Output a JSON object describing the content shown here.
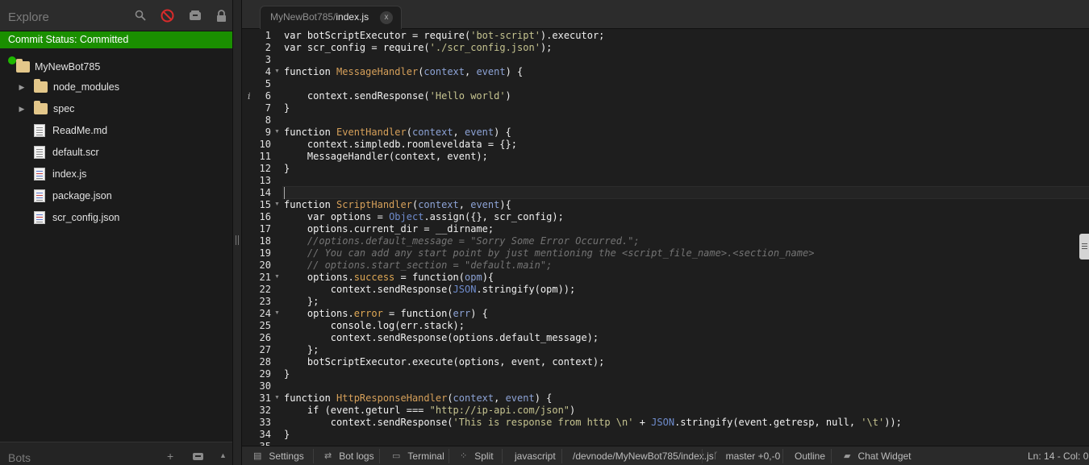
{
  "sidebar": {
    "title": "Explore",
    "commit_status": "Commit Status: Committed",
    "tree": [
      {
        "label": "MyNewBot785",
        "kind": "folder",
        "depth": 0,
        "arrow": false
      },
      {
        "label": "node_modules",
        "kind": "folder",
        "depth": 1,
        "arrow": true
      },
      {
        "label": "spec",
        "kind": "folder",
        "depth": 1,
        "arrow": true
      },
      {
        "label": "ReadMe.md",
        "kind": "file",
        "depth": 1,
        "arrow": false
      },
      {
        "label": "default.scr",
        "kind": "file",
        "depth": 1,
        "arrow": false
      },
      {
        "label": "index.js",
        "kind": "code",
        "depth": 1,
        "arrow": false
      },
      {
        "label": "package.json",
        "kind": "code",
        "depth": 1,
        "arrow": false
      },
      {
        "label": "scr_config.json",
        "kind": "code",
        "depth": 1,
        "arrow": false
      }
    ],
    "footer_title": "Bots"
  },
  "tab": {
    "path_prefix": "MyNewBot785/",
    "file_name": "index.js",
    "close_label": "x"
  },
  "editor": {
    "active_line": 14,
    "info_marker_line": 6,
    "fold_lines": [
      4,
      9,
      15,
      21,
      24,
      31
    ],
    "lines": [
      [
        [
          "kw",
          "var"
        ],
        [
          "t",
          " botScriptExecutor = "
        ],
        [
          "kw",
          "require"
        ],
        [
          "t",
          "("
        ],
        [
          "st",
          "'bot-script'"
        ],
        [
          "t",
          ").executor;"
        ]
      ],
      [
        [
          "kw",
          "var"
        ],
        [
          "t",
          " scr_config = "
        ],
        [
          "kw",
          "require"
        ],
        [
          "t",
          "("
        ],
        [
          "st",
          "'./scr_config.json'"
        ],
        [
          "t",
          ");"
        ]
      ],
      [],
      [
        [
          "kw",
          "function"
        ],
        [
          "t",
          " "
        ],
        [
          "fn",
          "MessageHandler"
        ],
        [
          "t",
          "("
        ],
        [
          "pm",
          "context"
        ],
        [
          "t",
          ", "
        ],
        [
          "pm",
          "event"
        ],
        [
          "t",
          ") {"
        ]
      ],
      [],
      [
        [
          "t",
          "    context.sendResponse("
        ],
        [
          "st",
          "'Hello world'"
        ],
        [
          "t",
          ")"
        ]
      ],
      [
        [
          "t",
          "}"
        ]
      ],
      [],
      [
        [
          "kw",
          "function"
        ],
        [
          "t",
          " "
        ],
        [
          "fn",
          "EventHandler"
        ],
        [
          "t",
          "("
        ],
        [
          "pm",
          "context"
        ],
        [
          "t",
          ", "
        ],
        [
          "pm",
          "event"
        ],
        [
          "t",
          ") {"
        ]
      ],
      [
        [
          "t",
          "    context.simpledb.roomleveldata = {};"
        ]
      ],
      [
        [
          "t",
          "    MessageHandler(context, event);"
        ]
      ],
      [
        [
          "t",
          "}"
        ]
      ],
      [],
      [],
      [
        [
          "kw",
          "function"
        ],
        [
          "t",
          " "
        ],
        [
          "fn",
          "ScriptHandler"
        ],
        [
          "t",
          "("
        ],
        [
          "pm",
          "context"
        ],
        [
          "t",
          ", "
        ],
        [
          "pm",
          "event"
        ],
        [
          "t",
          "){"
        ]
      ],
      [
        [
          "t",
          "    "
        ],
        [
          "kw",
          "var"
        ],
        [
          "t",
          " options = "
        ],
        [
          "bi",
          "Object"
        ],
        [
          "t",
          ".assign({}, scr_config);"
        ]
      ],
      [
        [
          "t",
          "    options.current_dir = __dirname;"
        ]
      ],
      [
        [
          "cm",
          "    //options.default_message = \"Sorry Some Error Occurred.\";"
        ]
      ],
      [
        [
          "cm",
          "    // You can add any start point by just mentioning the <script_file_name>.<section_name>"
        ]
      ],
      [
        [
          "cm",
          "    // options.start_section = \"default.main\";"
        ]
      ],
      [
        [
          "t",
          "    options."
        ],
        [
          "pr",
          "success"
        ],
        [
          "t",
          " = "
        ],
        [
          "kw",
          "function"
        ],
        [
          "t",
          "("
        ],
        [
          "pm",
          "opm"
        ],
        [
          "t",
          "){"
        ]
      ],
      [
        [
          "t",
          "        context.sendResponse("
        ],
        [
          "bi",
          "JSON"
        ],
        [
          "t",
          ".stringify(opm));"
        ]
      ],
      [
        [
          "t",
          "    };"
        ]
      ],
      [
        [
          "t",
          "    options."
        ],
        [
          "pr",
          "error"
        ],
        [
          "t",
          " = "
        ],
        [
          "kw",
          "function"
        ],
        [
          "t",
          "("
        ],
        [
          "pm",
          "err"
        ],
        [
          "t",
          ") {"
        ]
      ],
      [
        [
          "t",
          "        "
        ],
        [
          "kw",
          "console"
        ],
        [
          "t",
          "."
        ],
        [
          "kw",
          "log"
        ],
        [
          "t",
          "(err.stack);"
        ]
      ],
      [
        [
          "t",
          "        context.sendResponse(options.default_message);"
        ]
      ],
      [
        [
          "t",
          "    };"
        ]
      ],
      [
        [
          "t",
          "    botScriptExecutor.execute(options, event, context);"
        ]
      ],
      [
        [
          "t",
          "}"
        ]
      ],
      [],
      [
        [
          "kw",
          "function"
        ],
        [
          "t",
          " "
        ],
        [
          "fn",
          "HttpResponseHandler"
        ],
        [
          "t",
          "("
        ],
        [
          "pm",
          "context"
        ],
        [
          "t",
          ", "
        ],
        [
          "pm",
          "event"
        ],
        [
          "t",
          ") {"
        ]
      ],
      [
        [
          "t",
          "    "
        ],
        [
          "kw",
          "if"
        ],
        [
          "t",
          " (event.geturl === "
        ],
        [
          "st",
          "\"http://ip-api.com/json\""
        ],
        [
          "t",
          ")"
        ]
      ],
      [
        [
          "t",
          "        context.sendResponse("
        ],
        [
          "st",
          "'This is response from http \\n'"
        ],
        [
          "t",
          " + "
        ],
        [
          "bi",
          "JSON"
        ],
        [
          "t",
          ".stringify(event.getresp, "
        ],
        [
          "kw",
          "null"
        ],
        [
          "t",
          ", "
        ],
        [
          "st",
          "'\\t'"
        ],
        [
          "t",
          "));"
        ]
      ],
      [
        [
          "t",
          "}"
        ]
      ],
      [
        [
          "t",
          ""
        ]
      ]
    ]
  },
  "statusbar": {
    "settings": "Settings",
    "bot_logs": "Bot logs",
    "terminal": "Terminal",
    "split": "Split",
    "language": "javascript",
    "path": "/devnode/MyNewBot785/index.js",
    "branch": "master +0,-0",
    "outline": "Outline",
    "chat_widget": "Chat Widget",
    "cursor_pos": "Ln: 14 - Col: 0"
  },
  "colors": {
    "commit_green": "#1a8f00",
    "dot_green": "#1fb800",
    "block_red": "#d92b2b"
  }
}
